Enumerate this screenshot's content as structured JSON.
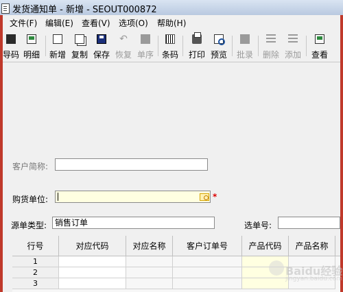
{
  "window": {
    "title": "发货通知单 - 新增 - SEOUT000872"
  },
  "menu": [
    {
      "label": "文件(F)"
    },
    {
      "label": "编辑(E)"
    },
    {
      "label": "查看(V)"
    },
    {
      "label": "选项(O)"
    },
    {
      "label": "帮助(H)"
    }
  ],
  "toolbar": [
    {
      "label": "导码",
      "icon": "import-code-icon",
      "enabled": true
    },
    {
      "label": "明细",
      "icon": "detail-icon",
      "enabled": true
    },
    {
      "label": "新增",
      "icon": "new-document-icon",
      "enabled": true
    },
    {
      "label": "复制",
      "icon": "copy-icon",
      "enabled": true
    },
    {
      "label": "保存",
      "icon": "save-disk-icon",
      "enabled": true
    },
    {
      "label": "恢复",
      "icon": "undo-icon",
      "enabled": false
    },
    {
      "label": "单序",
      "icon": "sequence-icon",
      "enabled": false
    },
    {
      "label": "条码",
      "icon": "barcode-icon",
      "enabled": true
    },
    {
      "label": "打印",
      "icon": "printer-icon",
      "enabled": true
    },
    {
      "label": "预览",
      "icon": "print-preview-icon",
      "enabled": true
    },
    {
      "label": "批录",
      "icon": "batch-entry-icon",
      "enabled": false
    },
    {
      "label": "删除",
      "icon": "delete-row-icon",
      "enabled": false
    },
    {
      "label": "添加",
      "icon": "add-row-icon",
      "enabled": false
    },
    {
      "label": "查看",
      "icon": "view-icon",
      "enabled": true
    }
  ],
  "form": {
    "customer_short_name": {
      "label": "客户简称:",
      "value": ""
    },
    "buyer": {
      "label": "购货单位:",
      "value": "",
      "required_mark": "*"
    },
    "source_type": {
      "label": "源单类型:",
      "value": "销售订单"
    },
    "select_no": {
      "label": "选单号:",
      "value": ""
    }
  },
  "grid": {
    "columns": [
      "行号",
      "对应代码",
      "对应名称",
      "客户订单号",
      "产品代码",
      "产品名称"
    ],
    "rows": [
      "1",
      "2",
      "3"
    ]
  },
  "colors": {
    "window_border": "#c0392b",
    "required_input_bg": "#ffffe1",
    "product_code_column_bg": "#ffffe1"
  },
  "watermark": {
    "text": "Baidu经验",
    "subtext": "jingyan.baidu.com"
  }
}
